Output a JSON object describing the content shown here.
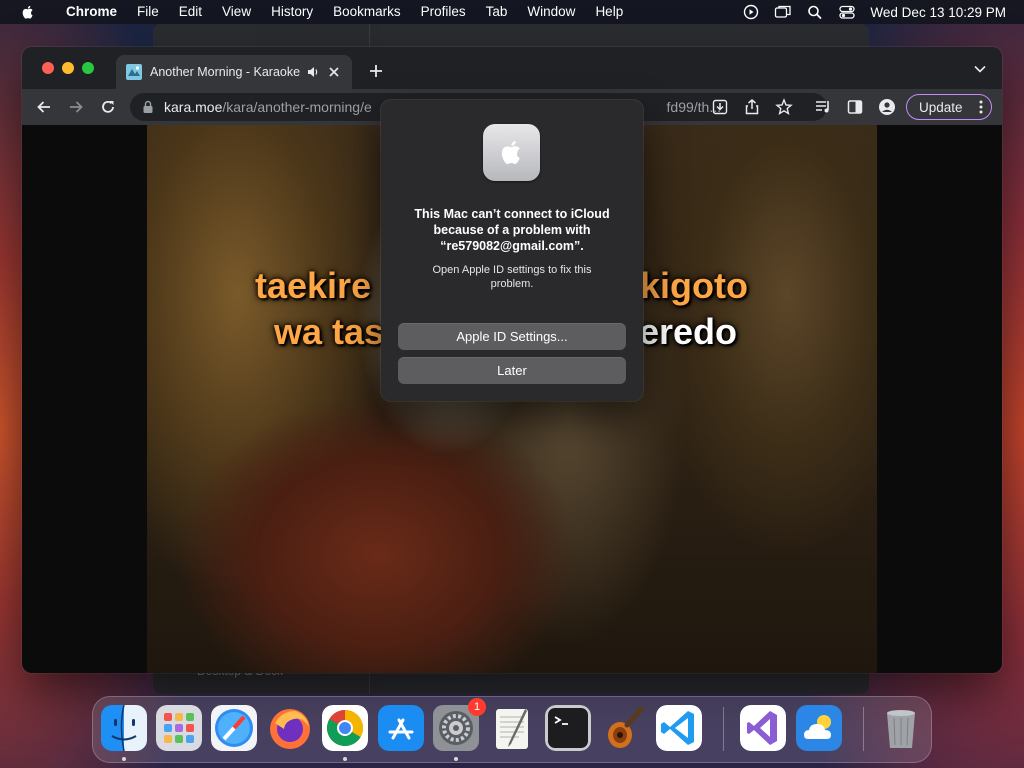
{
  "menubar": {
    "items": [
      "Chrome",
      "File",
      "Edit",
      "View",
      "History",
      "Bookmarks",
      "Profiles",
      "Tab",
      "Window",
      "Help"
    ],
    "clock": "Wed Dec 13  10:29 PM",
    "status_icons": [
      "play-circle-icon",
      "screens-icon",
      "search-icon",
      "control-center-icon"
    ]
  },
  "background_window": {
    "sidebar_label": "Desktop & Dock"
  },
  "browser": {
    "tab": {
      "title": "Another Morning - Karaoke",
      "icons": [
        "kara-moe-favicon",
        "audio-playing-icon",
        "close-icon"
      ]
    },
    "address": {
      "host": "kara.moe",
      "path": "/kara/another-morning/e",
      "path_tail": "fd99/th..."
    },
    "update_label": "Update"
  },
  "video": {
    "lyrics_line1_left": "taekire",
    "lyrics_line1_right": "ekigoto",
    "lyrics_line2_left": "wa tas",
    "lyrics_line2_right": "eredo",
    "colors": {
      "sung": "#ffa646",
      "unsung": "#ffffff"
    }
  },
  "alert": {
    "title": "This Mac can’t connect to iCloud because of a problem with “re579082@gmail.com”.",
    "message": "Open Apple ID settings to fix this problem.",
    "primary_button": "Apple ID Settings...",
    "secondary_button": "Later"
  },
  "dock": {
    "apps": [
      {
        "name": "Finder",
        "running": true
      },
      {
        "name": "Launchpad",
        "running": false
      },
      {
        "name": "Safari",
        "running": false
      },
      {
        "name": "Firefox",
        "running": false
      },
      {
        "name": "Google Chrome",
        "running": true
      },
      {
        "name": "App Store",
        "running": false
      },
      {
        "name": "System Settings",
        "running": true
      },
      {
        "name": "TextEdit",
        "running": false
      },
      {
        "name": "Terminal",
        "running": false
      },
      {
        "name": "GarageBand",
        "running": false
      },
      {
        "name": "Visual Studio Code",
        "running": false
      },
      {
        "name": "Visual Studio",
        "running": false
      },
      {
        "name": "Weather",
        "running": false
      },
      {
        "name": "Trash",
        "running": false
      }
    ],
    "system_settings_badge": "1"
  }
}
